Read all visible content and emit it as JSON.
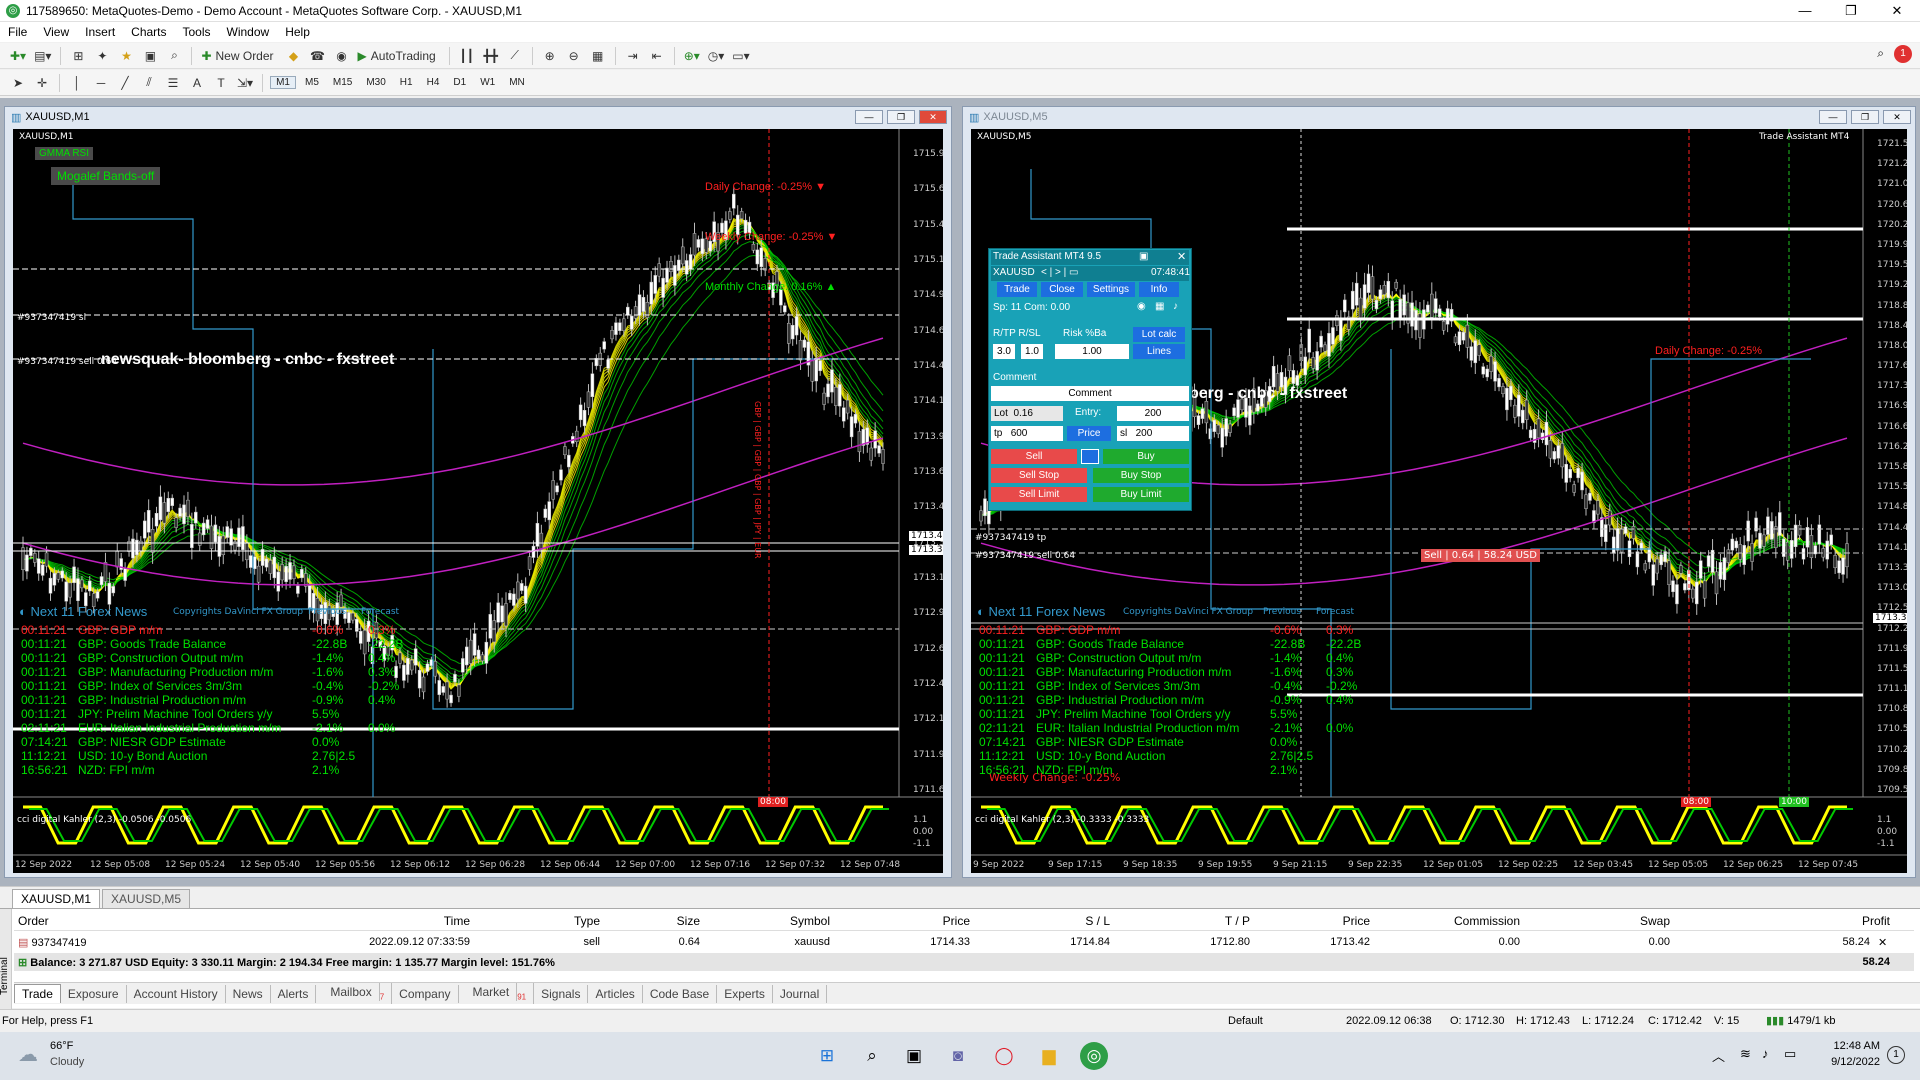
{
  "window": {
    "title": "117589650: MetaQuotes-Demo - Demo Account - MetaQuotes Software Corp. - XAUUSD,M1",
    "controls": [
      "—",
      "❐",
      "✕"
    ]
  },
  "menu": [
    "File",
    "View",
    "Insert",
    "Charts",
    "Tools",
    "Window",
    "Help"
  ],
  "toolbar": {
    "new_order": "New Order",
    "autotrading": "AutoTrading",
    "timeframes": [
      "M1",
      "M5",
      "M15",
      "M30",
      "H1",
      "H4",
      "D1",
      "W1",
      "MN"
    ],
    "active_timeframe": "M1",
    "notification_count": "1"
  },
  "chart1": {
    "window_title": "XAUUSD,M1",
    "symbol_label": "XAUUSD,M1",
    "indicator_gmma": "GMMA RSI",
    "indicator_mogalef": "Mogalef Bands-off",
    "daily_change": "Daily Change: -0.25%",
    "weekly_change": "Weekly Change: -0.25%",
    "monthly_change": "Monthly Change: 0.16%",
    "order_line_sl": "#937347419 sl",
    "order_line_sell": "#937347419 sell 0.64",
    "banner": "newsquak- bloomberg - cnbc - fxstreet",
    "prices": [
      "1715.90",
      "1715.65",
      "1715.40",
      "1715.15",
      "1714.90",
      "1714.65",
      "1714.40",
      "1714.15",
      "1713.90",
      "1713.65",
      "1713.42",
      "1713.31",
      "1713.15",
      "1712.90",
      "1712.65",
      "1712.40",
      "1712.15",
      "1711.90",
      "1711.65"
    ],
    "price_tags": {
      "bid": "1713.42",
      "ask": "1713.31"
    },
    "times": [
      "12 Sep 2022",
      "12 Sep 05:08",
      "12 Sep 05:24",
      "12 Sep 05:40",
      "12 Sep 05:56",
      "12 Sep 06:12",
      "12 Sep 06:28",
      "12 Sep 06:44",
      "12 Sep 07:00",
      "12 Sep 07:16",
      "12 Sep 07:32",
      "12 Sep 07:48"
    ],
    "time_marker": "08:00",
    "cci_label": "cci digital Kahler (2,3) -0.0506 -0.0506",
    "cci_scale": [
      "1.1",
      "0.00",
      "-1.1"
    ],
    "news_header": "Next 11 Forex News",
    "news_col_prev": "Previous",
    "news_col_fore": "Forecast",
    "news_copyright": "Copyrights DaVinci FX Group",
    "vertical_text": "GBP | GBP | GBP | GBP | GBP | JPY | EUR"
  },
  "chart2": {
    "window_title": "XAUUSD,M5",
    "symbol_label": "XAUUSD,M5",
    "ta_corner": "Trade Assistant MT4",
    "daily_change": "Daily Change: -0.25%",
    "banner": "berg - cnbc - fxstreet",
    "sell_tag": "Sell | 0.64 | 58.24 USD",
    "order_line_tp": "#937347419 tp",
    "order_line_sell": "#937347419 sell 0.64",
    "prices": [
      "1721.50",
      "1721.25",
      "1721.00",
      "1720.60",
      "1720.20",
      "1719.95",
      "1719.55",
      "1719.20",
      "1718.85",
      "1718.45",
      "1718.00",
      "1717.65",
      "1717.35",
      "1716.95",
      "1716.60",
      "1716.25",
      "1715.85",
      "1715.50",
      "1714.80",
      "1714.45",
      "1714.10",
      "1713.31",
      "1713.00",
      "1712.55",
      "1712.25",
      "1711.90",
      "1711.50",
      "1711.15",
      "1710.85",
      "1710.50",
      "1710.20",
      "1709.85",
      "1709.55"
    ],
    "price_tag": "1713.31",
    "times": [
      "9 Sep 2022",
      "9 Sep 17:15",
      "9 Sep 18:35",
      "9 Sep 19:55",
      "9 Sep 21:15",
      "9 Sep 22:35",
      "12 Sep 01:05",
      "12 Sep 02:25",
      "12 Sep 03:45",
      "12 Sep 05:05",
      "12 Sep 06:25",
      "12 Sep 07:45"
    ],
    "time_marker_red": "08:00",
    "time_marker_green": "10:00",
    "cci_label": "cci digital Kahler (2,3) -0.3333 -0.3333",
    "cci_scale": [
      "1.1",
      "0.00",
      "-1.1"
    ],
    "weekly_overlay": "Weekly Change: -0.25%",
    "news_header": "Next 11 Forex News",
    "news_col_prev": "Previous",
    "news_col_fore": "Forecast",
    "news_copyright": "Copyrights DaVinci FX Group"
  },
  "news": [
    {
      "time": "00:11:21",
      "name": "GBP: GDP m/m",
      "prev": "-0.6%",
      "fore": "0.3%",
      "red": true
    },
    {
      "time": "00:11:21",
      "name": "GBP: Goods Trade Balance",
      "prev": "-22.8B",
      "fore": "-22.2B",
      "red": false
    },
    {
      "time": "00:11:21",
      "name": "GBP: Construction Output m/m",
      "prev": "-1.4%",
      "fore": "0.4%",
      "red": false
    },
    {
      "time": "00:11:21",
      "name": "GBP: Manufacturing Production m/m",
      "prev": "-1.6%",
      "fore": "0.3%",
      "red": false
    },
    {
      "time": "00:11:21",
      "name": "GBP: Index of Services 3m/3m",
      "prev": "-0.4%",
      "fore": "-0.2%",
      "red": false
    },
    {
      "time": "00:11:21",
      "name": "GBP: Industrial Production m/m",
      "prev": "-0.9%",
      "fore": "0.4%",
      "red": false
    },
    {
      "time": "00:11:21",
      "name": "JPY: Prelim Machine Tool Orders y/y",
      "prev": "5.5%",
      "fore": "",
      "red": false
    },
    {
      "time": "02:11:21",
      "name": "EUR: Italian Industrial Production m/m",
      "prev": "-2.1%",
      "fore": "0.0%",
      "red": false
    },
    {
      "time": "07:14:21",
      "name": "GBP: NIESR GDP Estimate",
      "prev": "0.0%",
      "fore": "",
      "red": false
    },
    {
      "time": "11:12:21",
      "name": "USD: 10-y Bond Auction",
      "prev": "2.76|2.5",
      "fore": "",
      "red": false
    },
    {
      "time": "16:56:21",
      "name": "NZD: FPI m/m",
      "prev": "2.1%",
      "fore": "",
      "red": false
    }
  ],
  "trade_assistant": {
    "title": "Trade Assistant MT4 9.5",
    "symbol": "XAUUSD",
    "nav": "< | > | ▭",
    "clock": "07:48:41",
    "tabs": [
      "Trade",
      "Close",
      "Settings",
      "Info"
    ],
    "spread": "Sp: 11  Com: 0.00",
    "rr_label": "R/TP  R/SL",
    "risk_label": "Risk %Ba",
    "rtp": "3.0",
    "rsl": "1.0",
    "risk": "1.00",
    "lot_calc": "Lot calc",
    "lines": "Lines",
    "comment_label": "Comment",
    "comment_field": "Comment",
    "lot_label": "Lot",
    "lot": "0.16",
    "entry_label": "Entry:",
    "entry": "200",
    "tp_label": "tp",
    "tp": "600",
    "price_btn": "Price",
    "sl_label": "sl",
    "sl": "200",
    "sell": "Sell",
    "buy": "Buy",
    "sell_stop": "Sell Stop",
    "buy_stop": "Buy Stop",
    "sell_limit": "Sell Limit",
    "buy_limit": "Buy Limit"
  },
  "chart_tabs": [
    "XAUUSD,M1",
    "XAUUSD,M5"
  ],
  "terminal": {
    "side_label": "Terminal",
    "columns": [
      "Order",
      "Time",
      "Type",
      "Size",
      "Symbol",
      "Price",
      "S / L",
      "T / P",
      "Price",
      "Commission",
      "Swap",
      "Profit"
    ],
    "rows": [
      {
        "order": "937347419",
        "time": "2022.09.12 07:33:59",
        "type": "sell",
        "size": "0.64",
        "symbol": "xauusd",
        "price": "1714.33",
        "sl": "1714.84",
        "tp": "1712.80",
        "cur_price": "1713.42",
        "commission": "0.00",
        "swap": "0.00",
        "profit": "58.24"
      }
    ],
    "balance_text": "Balance: 3 271.87 USD  Equity: 3 330.11  Margin: 2 194.34  Free margin: 1 135.77  Margin level: 151.76%",
    "balance_profit": "58.24",
    "tabs": [
      "Trade",
      "Exposure",
      "Account History",
      "News",
      "Alerts",
      "Mailbox",
      "Company",
      "Market",
      "Signals",
      "Articles",
      "Code Base",
      "Experts",
      "Journal"
    ],
    "mailbox_badge": "7",
    "market_badge": "91"
  },
  "status": {
    "help": "For Help, press F1",
    "profile": "Default",
    "datetime": "2022.09.12 06:38",
    "open": "O: 1712.30",
    "high": "H: 1712.43",
    "low": "L: 1712.24",
    "close": "C: 1712.42",
    "volume": "V: 15",
    "traffic": "1479/1 kb"
  },
  "taskbar": {
    "temp": "66°F",
    "weather": "Cloudy",
    "time": "12:48 AM",
    "date": "9/12/2022",
    "notif": "1"
  },
  "colors": {
    "chart_bg": "#000000",
    "ema_fast": "#ffff00",
    "ema_slow": "#00c800",
    "band": "#c020c0",
    "mogalef": "#3399cc",
    "news_green": "#00e000",
    "down_red": "#ff2020",
    "ta_panel": "#19a2b7"
  }
}
